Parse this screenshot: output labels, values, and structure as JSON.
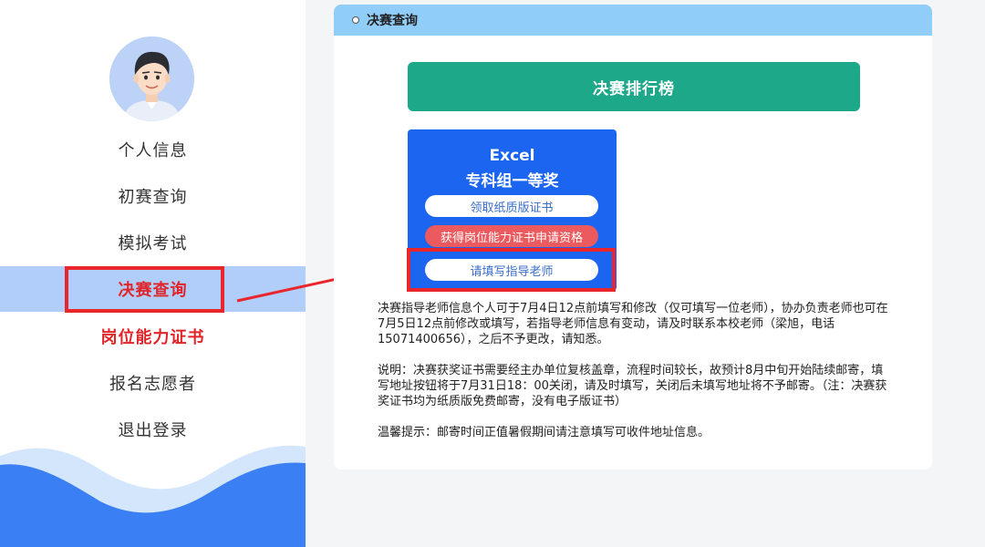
{
  "sidebar": {
    "items": [
      {
        "label": "个人信息"
      },
      {
        "label": "初赛查询"
      },
      {
        "label": "模拟考试"
      },
      {
        "label": "决赛查询"
      },
      {
        "label": "岗位能力证书"
      },
      {
        "label": "报名志愿者"
      },
      {
        "label": "退出登录"
      }
    ],
    "active_index": 3
  },
  "main": {
    "header_title": "决赛查询",
    "rank_button": "决赛排行榜",
    "award": {
      "line1": "Excel",
      "line2": "专科组一等奖",
      "buttons": {
        "paper_cert": "领取纸质版证书",
        "job_cert": "获得岗位能力证书申请资格",
        "teacher": "请填写指导老师"
      }
    },
    "notes": {
      "teacher": "决赛指导老师信息个人可于7月4日12点前填写和修改（仅可填写一位老师），协办负责老师也可在7月5日12点前修改或填写，若指导老师信息有变动，请及时联系本校老师（梁旭，电话15071400656），之后不予更改，请知悉。",
      "explain": "说明：决赛获奖证书需要经主办单位复核盖章，流程时间较长，故预计8月中旬开始陆续邮寄，填写地址按钮将于7月31日18：00关闭，请及时填写，关闭后未填写地址将不予邮寄。（注：决赛获奖证书均为纸质版免费邮寄，没有电子版证书）",
      "tip": "温馨提示：邮寄时间正值暑假期间请注意填写可收件地址信息。"
    }
  },
  "colors": {
    "accent_green": "#1ca889",
    "award_blue": "#1b65f0",
    "header_blue": "#91cdf9",
    "highlight_red": "#e8262b",
    "active_bg": "#b1cdfa"
  }
}
